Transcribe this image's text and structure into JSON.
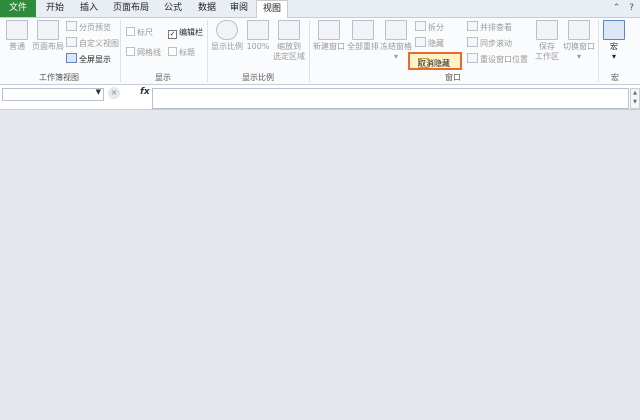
{
  "tabs": [
    "文件",
    "开始",
    "插入",
    "页面布局",
    "公式",
    "数据",
    "审阅",
    "视图"
  ],
  "groups": {
    "workbook_views": {
      "label": "工作簿视图",
      "normal": "普通",
      "page_layout": "页面布局",
      "page_break_preview": "分页预览",
      "custom_views": "自定义视图",
      "full_screen": "全屏显示"
    },
    "show": {
      "label": "显示",
      "ruler": "标尺",
      "formula_bar": "编辑栏",
      "gridlines": "网格线",
      "headings": "标题"
    },
    "zoom": {
      "label": "显示比例",
      "zoom": "显示比例",
      "zoom100": "100%",
      "zoom_selection": [
        "缩放到",
        "选定区域"
      ]
    },
    "window": {
      "label": "窗口",
      "new_window": "新建窗口",
      "arrange_all": "全部重排",
      "freeze_panes": "冻结窗格",
      "split": "拆分",
      "hide": "隐藏",
      "unhide": "取消隐藏",
      "view_side_by_side": "并排查看",
      "sync_scroll": "同步滚动",
      "reset_position": "重设窗口位置",
      "save_workspace": [
        "保存",
        "工作区"
      ],
      "switch_windows": "切换窗口"
    },
    "macros": {
      "label": "宏",
      "macros": "宏"
    }
  },
  "formula_bar": {
    "fx": "fx",
    "name_box_value": "",
    "formula_value": ""
  }
}
